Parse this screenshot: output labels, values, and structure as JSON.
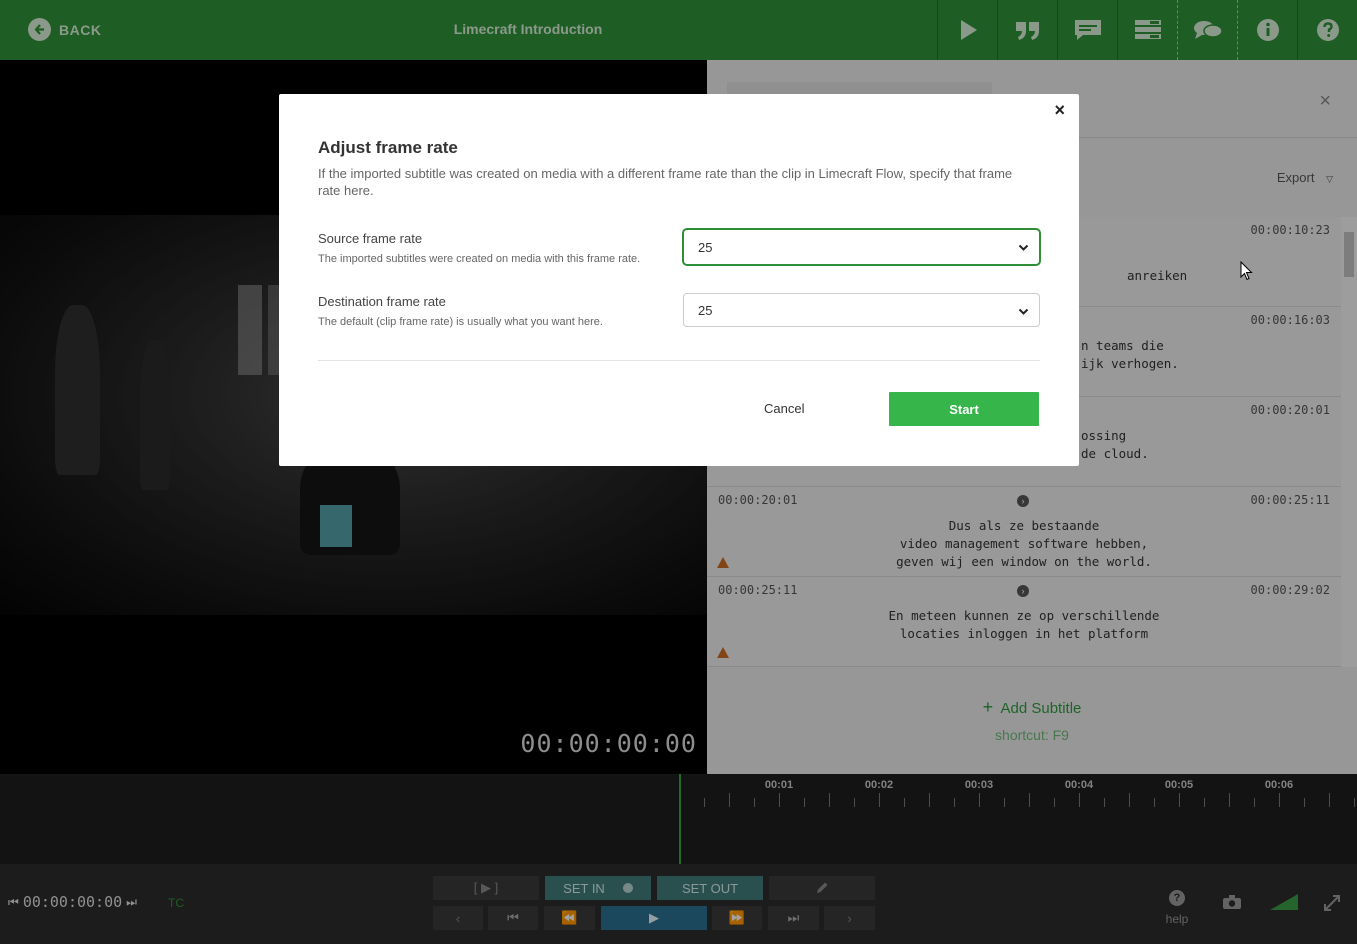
{
  "header": {
    "back_label": "BACK",
    "title": "Limecraft Introduction",
    "toolbar_icons": [
      "play-icon",
      "quote-icon",
      "subtitle-icon",
      "list-icon",
      "chat-icon",
      "info-icon",
      "help-icon"
    ]
  },
  "video": {
    "timecode": "00:00:00:00"
  },
  "panel": {
    "close_label": "×",
    "export_label": "Export",
    "subtitles": [
      {
        "in": "",
        "out": "00:00:10:23",
        "text": "anreiken",
        "warning": false
      },
      {
        "in": "",
        "out": "00:00:16:03",
        "text": "n teams die\nijk verhogen.",
        "warning": false
      },
      {
        "in": "",
        "out": "00:00:20:01",
        "text": "ossing\nde cloud.",
        "warning": false
      },
      {
        "in": "00:00:20:01",
        "out": "00:00:25:11",
        "text": "Dus als ze bestaande\nvideo management software hebben,\ngeven wij een window on the world.",
        "warning": true
      },
      {
        "in": "00:00:25:11",
        "out": "00:00:29:02",
        "text": "En meteen kunnen ze op verschillende\nlocaties inloggen in het platform",
        "warning": true
      }
    ],
    "add_subtitle_label": "Add Subtitle",
    "shortcut_label": "shortcut: F9"
  },
  "timeline": {
    "labels": [
      "00:01",
      "00:02",
      "00:03",
      "00:04",
      "00:05",
      "00:06"
    ]
  },
  "controls": {
    "timecode": "00:00:00:00",
    "tc_label": "TC",
    "play_range_label": "[ ▶ ]",
    "set_in_label": "SET IN",
    "set_out_label": "SET OUT",
    "help_label": "help"
  },
  "modal": {
    "close_label": "×",
    "title": "Adjust frame rate",
    "description": "If the imported subtitle was created on media with a different frame rate than the clip in Limecraft Flow, specify that frame rate here.",
    "source": {
      "label": "Source frame rate",
      "hint": "The imported subtitles were created on media with this frame rate.",
      "value": "25"
    },
    "destination": {
      "label": "Destination frame rate",
      "hint": "The default (clip frame rate) is usually what you want here.",
      "value": "25"
    },
    "cancel_label": "Cancel",
    "start_label": "Start"
  },
  "colors": {
    "brand_green": "#2f8f36",
    "start_green": "#36b54a",
    "warning": "#c96a22"
  }
}
